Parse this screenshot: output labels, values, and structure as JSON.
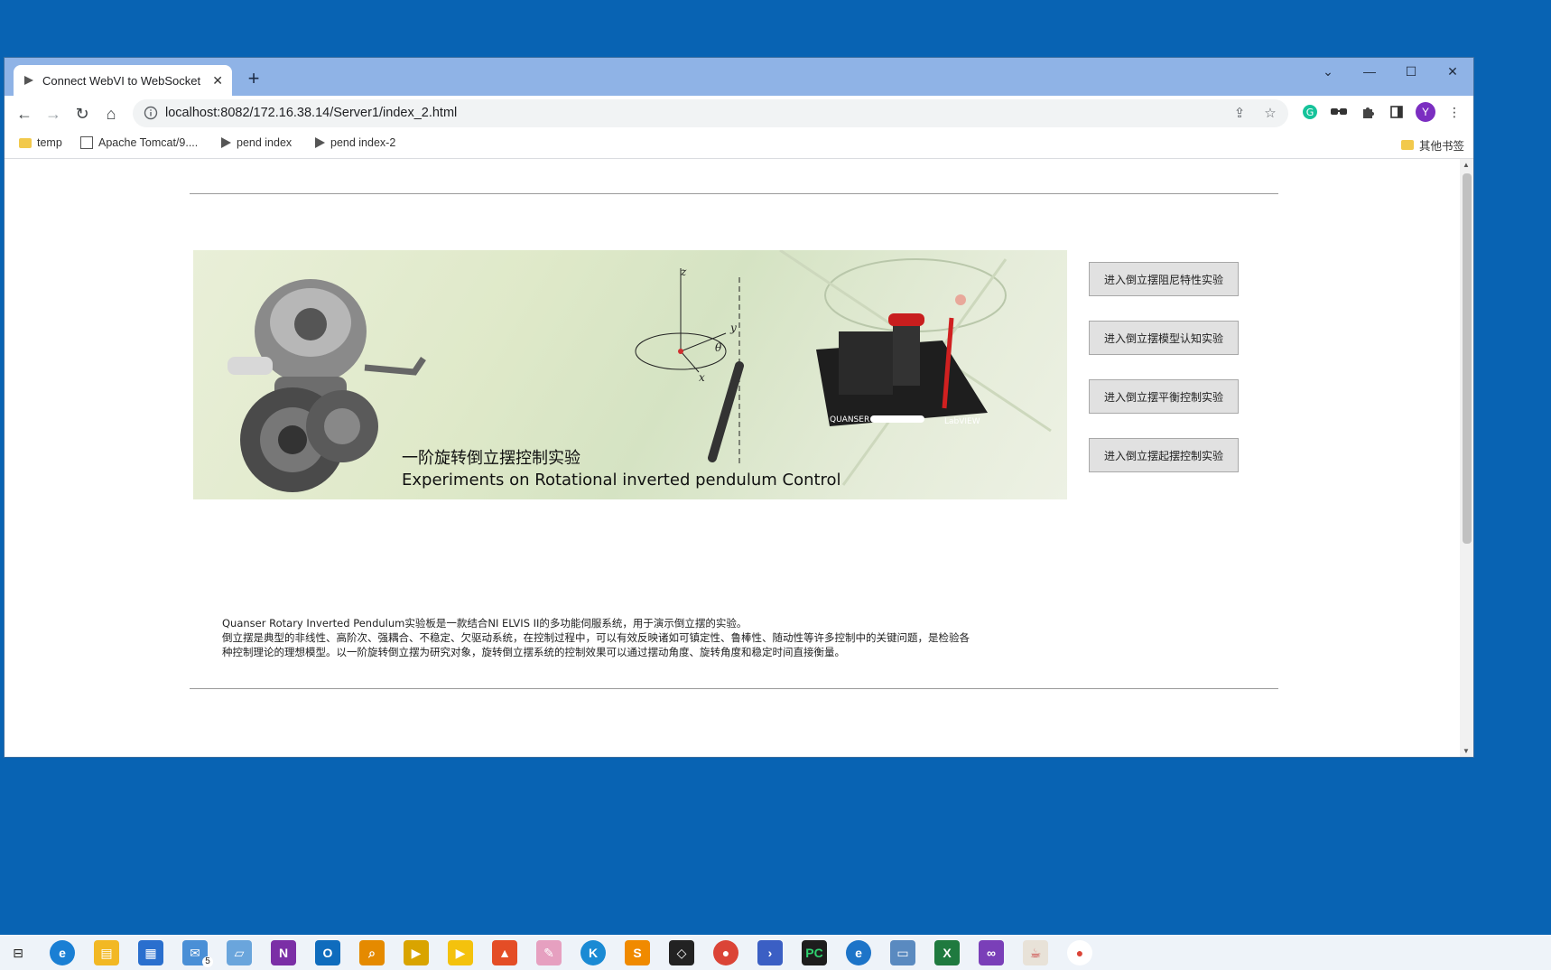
{
  "browser": {
    "tab_title": "Connect WebVI to WebSocket",
    "url": "localhost:8082/172.16.38.14/Server1/index_2.html",
    "avatar_letter": "Y",
    "bookmarks": [
      "temp",
      "Apache Tomcat/9....",
      "pend index",
      "pend index-2"
    ],
    "other_bookmarks": "其他书签"
  },
  "page": {
    "banner": {
      "title_cn": "一阶旋转倒立摆控制实验",
      "title_en": "Experiments on Rotational inverted pendulum Control",
      "logos": [
        "QUANSER",
        "LabVIEW"
      ]
    },
    "buttons": [
      "进入倒立摆阻尼特性实验",
      "进入倒立摆模型认知实验",
      "进入倒立摆平衡控制实验",
      "进入倒立摆起摆控制实验"
    ],
    "description": [
      "Quanser Rotary Inverted Pendulum实验板是一款结合NI ELVIS II的多功能伺服系统，用于演示倒立摆的实验。",
      "倒立摆是典型的非线性、高阶次、强耦合、不稳定、欠驱动系统，在控制过程中，可以有效反映诸如可镇定性、鲁棒性、随动性等许多控制中的关键问题，是检验各",
      "种控制理论的理想模型。以一阶旋转倒立摆为研究对象，旋转倒立摆系统的控制效果可以通过摆动角度、旋转角度和稳定时间直接衡量。"
    ]
  },
  "taskbar": {
    "badge": "5"
  }
}
